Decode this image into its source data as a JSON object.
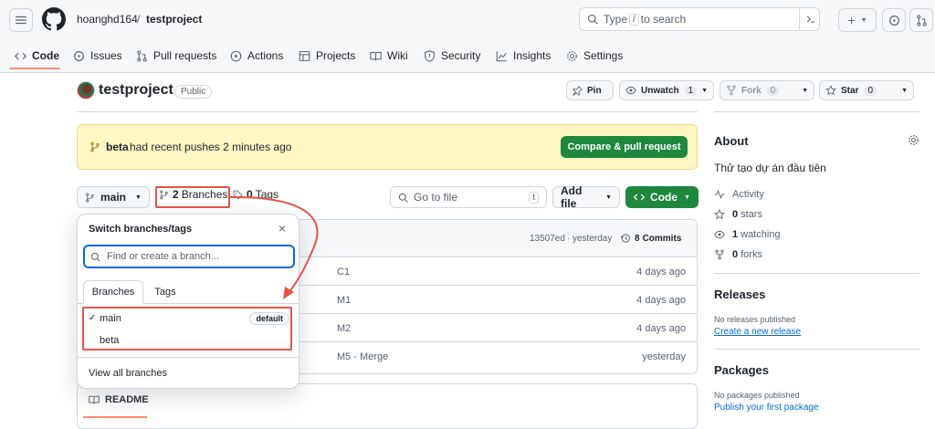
{
  "header": {
    "owner": "hoanghd164",
    "separator": "/",
    "repo": "testproject",
    "search_prefix": "Type",
    "search_key": "/",
    "search_suffix": "to search"
  },
  "nav": [
    {
      "label": "Code",
      "icon": "code-icon"
    },
    {
      "label": "Issues",
      "icon": "issue-icon"
    },
    {
      "label": "Pull requests",
      "icon": "pull-request-icon"
    },
    {
      "label": "Actions",
      "icon": "play-icon"
    },
    {
      "label": "Projects",
      "icon": "table-icon"
    },
    {
      "label": "Wiki",
      "icon": "book-icon"
    },
    {
      "label": "Security",
      "icon": "shield-icon"
    },
    {
      "label": "Insights",
      "icon": "graph-icon"
    },
    {
      "label": "Settings",
      "icon": "gear-icon"
    }
  ],
  "repo_header": {
    "title": "testproject",
    "visibility": "Public",
    "pin_label": "Pin",
    "watch_label": "Unwatch",
    "watch_count": "1",
    "fork_label": "Fork",
    "fork_count": "0",
    "star_label": "Star",
    "star_count": "0"
  },
  "banner": {
    "branch": "beta",
    "text": "had recent pushes 2 minutes ago",
    "button": "Compare & pull request"
  },
  "toolbar": {
    "branch": "main",
    "branches_count": "2",
    "branches_label": "Branches",
    "tags_count": "0",
    "tags_label": "Tags",
    "goto_placeholder": "Go to file",
    "goto_key": "t",
    "add_file": "Add file",
    "code": "Code"
  },
  "commit_bar": {
    "hash": "13507ed",
    "sep": "·",
    "when": "yesterday",
    "commits_count": "8",
    "commits_label": "Commits"
  },
  "files": [
    {
      "message": "C1",
      "when": "4 days ago"
    },
    {
      "message": "M1",
      "when": "4 days ago"
    },
    {
      "message": "M2",
      "when": "4 days ago"
    },
    {
      "message": "M5 - Merge",
      "when": "yesterday"
    }
  ],
  "readme": {
    "label": "README"
  },
  "popup": {
    "title": "Switch branches/tags",
    "placeholder": "Find or create a branch...",
    "tab_branches": "Branches",
    "tab_tags": "Tags",
    "branches": [
      {
        "name": "main",
        "checked": "✓",
        "badge": "default"
      },
      {
        "name": "beta",
        "checked": "",
        "badge": ""
      }
    ],
    "view_all": "View all branches"
  },
  "about": {
    "title": "About",
    "description": "Thử tạo dự án đầu tiên",
    "activity": "Activity",
    "stars_count": "0",
    "stars_label": "stars",
    "watching_count": "1",
    "watching_label": "watching",
    "forks_count": "0",
    "forks_label": "forks"
  },
  "releases": {
    "title": "Releases",
    "none": "No releases published",
    "link": "Create a new release"
  },
  "packages": {
    "title": "Packages",
    "none": "No packages published",
    "link": "Publish your first package"
  },
  "colors": {
    "accent_green": "#1f883d",
    "annotation_red": "#e5534b",
    "focus_blue": "#0969da",
    "banner_bg": "#fff8c5"
  }
}
